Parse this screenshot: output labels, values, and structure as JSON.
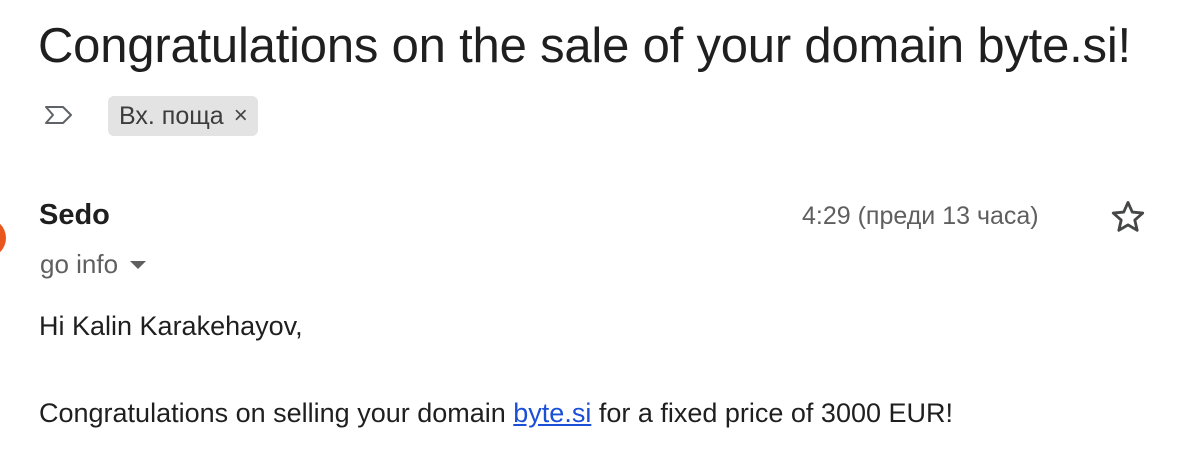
{
  "email": {
    "subject": "Congratulations on the sale of your domain byte.si!",
    "label": "Вх. поща",
    "label_remove_glyph": "×",
    "sender": "Sedo",
    "recipient": "go info",
    "time": "4:29 (преди 13 часа)",
    "body": {
      "greeting": "Hi Kalin Karakehayov,",
      "message_before": "Congratulations on selling your domain ",
      "link_text": "byte.si",
      "message_after": " for a fixed price of 3000 EUR!"
    }
  },
  "icons": {
    "importance": "importance-marker-icon",
    "star": "star-icon",
    "caret": "chevron-down-icon"
  },
  "colors": {
    "avatar": "#e8571e",
    "link": "#1a4fd6",
    "chip": "#e3e3e3"
  }
}
